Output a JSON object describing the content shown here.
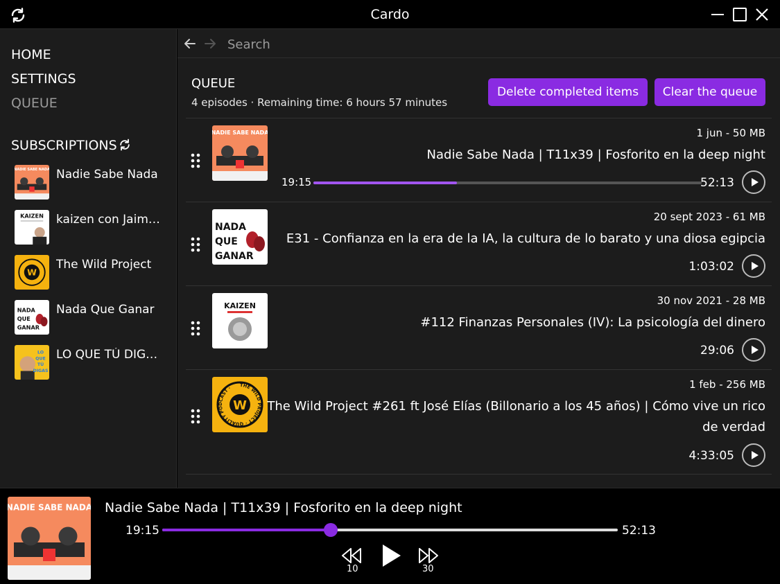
{
  "app": {
    "title": "Cardo"
  },
  "sidebar": {
    "nav": [
      {
        "label": "HOME"
      },
      {
        "label": "SETTINGS"
      },
      {
        "label": "QUEUE"
      }
    ],
    "subscriptions_title": "SUBSCRIPTIONS",
    "subscriptions": [
      {
        "name": "Nadie Sabe Nada"
      },
      {
        "name": "kaizen con Jaime Rodríguez de Santiago"
      },
      {
        "name": "The Wild Project"
      },
      {
        "name": "Nada Que Ganar"
      },
      {
        "name": "LO QUE TÚ DIGAS con Álex Fidalgo"
      }
    ]
  },
  "search": {
    "placeholder": "Search"
  },
  "queue": {
    "title": "QUEUE",
    "summary": "4 episodes · Remaining time: 6 hours 57 minutes",
    "delete_completed_label": "Delete completed items",
    "clear_label": "Clear the queue",
    "episodes": [
      {
        "meta": "1 jun - 50 MB",
        "title": "Nadie Sabe Nada | T11x39 | Fosforito en la deep night",
        "current": "19:15",
        "duration": "52:13",
        "progress": 0.37
      },
      {
        "meta": "20 sept 2023 - 61 MB",
        "title": "E31 - Confianza en la era de la IA, la cultura de lo barato y una diosa egipcia",
        "duration": "1:03:02"
      },
      {
        "meta": "30 nov 2021 - 28 MB",
        "title": "#112 Finanzas Personales (IV): La psicología del dinero",
        "duration": "29:06"
      },
      {
        "meta": "1 feb - 256 MB",
        "title": "The Wild Project #261 ft José Elías (Billonario a los 45 años) | Cómo vive un rico de verdad",
        "duration": "4:33:05"
      }
    ]
  },
  "thumb_text": {
    "nsn": "NADIE SABE NADA",
    "kaizen": "KAIZEN",
    "nqg": [
      "NADA",
      "QUE",
      "GANAR"
    ],
    "wild_ring": "THE WILD PROJECT · QUALITY PODCAST ·",
    "wild_letter": "W",
    "lqtd": [
      "LO",
      "QUE",
      "TÚ",
      "DIGAS"
    ]
  },
  "player": {
    "title": "Nadie Sabe Nada | T11x39 | Fosforito en la deep night",
    "current": "19:15",
    "duration": "52:13",
    "progress": 0.37,
    "rewind_label": "10",
    "forward_label": "30"
  },
  "colors": {
    "accent": "#8a2be2",
    "background": "#1c1c1c",
    "titlebar": "#000000"
  }
}
